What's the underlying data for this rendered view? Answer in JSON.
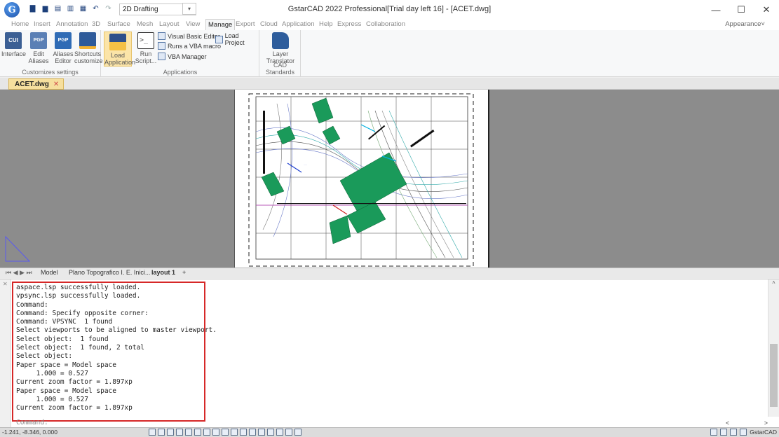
{
  "titlebar": {
    "title": "GstarCAD 2022 Professional[Trial day left 16] - [ACET.dwg]",
    "workspace": "2D Drafting",
    "logo": "G",
    "minimize": "—",
    "maximize": "☐",
    "close": "✕"
  },
  "ribbon_tabs": [
    "Home",
    "Insert",
    "Annotation",
    "3D",
    "Surface",
    "Mesh",
    "Layout",
    "View",
    "Manage",
    "Export",
    "Cloud",
    "Application",
    "Help",
    "Express",
    "Collaboration"
  ],
  "active_tab": "Manage",
  "appearance": "Appearance˅",
  "ribbon": {
    "customize": {
      "label": "Customizes settings",
      "interface": "Interface",
      "edit": "Edit",
      "edit2": "Aliases",
      "aliases": "Aliases",
      "aliases2": "Editor",
      "shortcuts": "Shortcuts",
      "shortcuts2": "customize"
    },
    "applications": {
      "label": "Applications",
      "load": "Load",
      "load2": "Application",
      "run": "Run",
      "run2": "Script...",
      "vbe": "Visual Basic Editor",
      "load_project": "Load Project",
      "runs_vba": "Runs a VBA macro",
      "vba_manager": "VBA Manager"
    },
    "cad_standards": {
      "label": "CAD Standards",
      "layer": "Layer",
      "layer2": "Translator"
    }
  },
  "doc_tab": {
    "name": "ACET.dwg",
    "close": "✕"
  },
  "layout_tabs": {
    "nav": "⏮ ◀ ▶ ⏭",
    "model": "Model",
    "plano": "Plano Topografico I. E. Inici...",
    "layout1": "layout 1",
    "add": "+"
  },
  "command_lines": [
    "aspace.lsp successfully loaded.",
    "vpsync.lsp successfully loaded.",
    "Command:",
    "Command: Specify opposite corner:",
    "Command: VPSYNC  1 found",
    "Select viewports to be aligned to master viewport.",
    "Select object:  1 found",
    "Select object:  1 found, 2 total",
    "Select object:",
    "Paper space = Model space",
    "     1.000 = 0.527",
    "Current zoom factor = 1.897xp",
    "Paper space = Model space",
    "     1.000 = 0.527",
    "Current zoom factor = 1.897xp"
  ],
  "command_prompt": "Command:",
  "statusbar": {
    "coords": "-1.241, -8.346, 0.000",
    "brand": "GstarCAD"
  },
  "colors": {
    "accent_tab": "#f6df9e",
    "highlight_box": "#d62828",
    "paper_bg": "#8c8c8c",
    "hatch_green": "#1a9a5a"
  }
}
